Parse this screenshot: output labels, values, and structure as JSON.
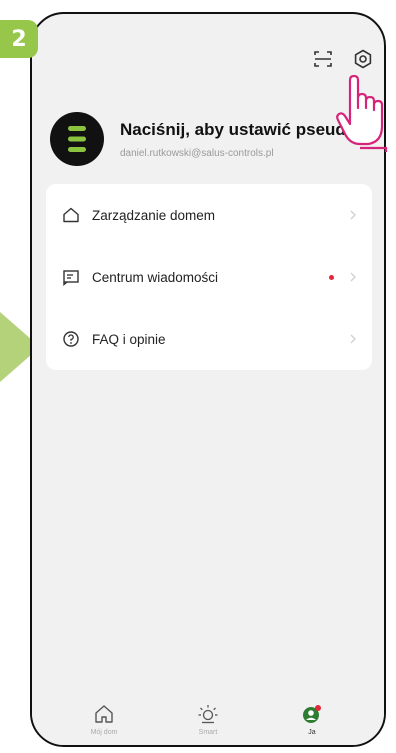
{
  "step": {
    "number": "2"
  },
  "profile": {
    "name": "Naciśnij, aby ustawić pseud...",
    "email": "daniel.rutkowski@salus-controls.pl"
  },
  "menu": {
    "items": [
      {
        "label": "Zarządzanie domem",
        "icon": "home-icon",
        "badge": false
      },
      {
        "label": "Centrum wiadomości",
        "icon": "message-icon",
        "badge": true
      },
      {
        "label": "FAQ i opinie",
        "icon": "help-icon",
        "badge": false
      }
    ]
  },
  "tabs": [
    {
      "label": "Mój dom",
      "icon": "home-icon",
      "active": false
    },
    {
      "label": "Smart",
      "icon": "sun-icon",
      "active": false
    },
    {
      "label": "Ja",
      "icon": "user-icon",
      "active": true
    }
  ],
  "colors": {
    "accent_green": "#96c74a",
    "hand_outline": "#d6247a",
    "badge_red": "#e0283a",
    "background": "#f1f1f1"
  }
}
